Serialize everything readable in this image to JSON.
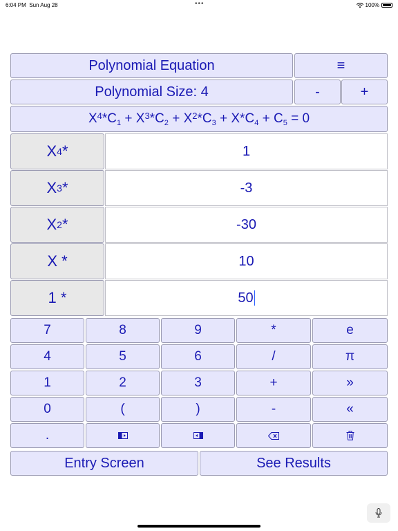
{
  "status": {
    "time": "6:04 PM",
    "date": "Sun Aug 28",
    "battery": "100%"
  },
  "header": {
    "title": "Polynomial Equation",
    "menu_icon": "≡",
    "size_label": "Polynomial Size: 4",
    "decrement": "-",
    "increment": "+"
  },
  "formula": {
    "t1_base": "X",
    "t1_exp": "4",
    "t1_c": "*C",
    "t1_sub": "1",
    "t2_base": " + X",
    "t2_exp": "3",
    "t2_c": "*C",
    "t2_sub": "2",
    "t3_base": " + X",
    "t3_exp": "2",
    "t3_c": "*C",
    "t3_sub": "3",
    "t4": " + X*C",
    "t4_sub": "4",
    "t5": " + C",
    "t5_sub": "5",
    "rhs": " = 0"
  },
  "rows": [
    {
      "label_base": "X",
      "label_exp": "4",
      "label_tail": " *",
      "value": "1"
    },
    {
      "label_base": "X",
      "label_exp": "3",
      "label_tail": " *",
      "value": "-3"
    },
    {
      "label_base": "X",
      "label_exp": "2",
      "label_tail": " *",
      "value": "-30"
    },
    {
      "label_base": "X *",
      "label_exp": "",
      "label_tail": "",
      "value": "10"
    },
    {
      "label_base": "1 *",
      "label_exp": "",
      "label_tail": "",
      "value": "50"
    }
  ],
  "keypad": [
    [
      "7",
      "8",
      "9",
      "*",
      "e"
    ],
    [
      "4",
      "5",
      "6",
      "/",
      "π"
    ],
    [
      "1",
      "2",
      "3",
      "+",
      "»"
    ],
    [
      "0",
      "(",
      ")",
      "-",
      "«"
    ],
    [
      ".",
      "cursor-left-icon",
      "cursor-right-icon",
      "backspace-icon",
      "trash-icon"
    ]
  ],
  "footer": {
    "entry": "Entry Screen",
    "results": "See Results"
  },
  "colors": {
    "button_bg": "#e6e6fc",
    "text": "#1a1ab4",
    "label_bg": "#e8e8e8"
  }
}
